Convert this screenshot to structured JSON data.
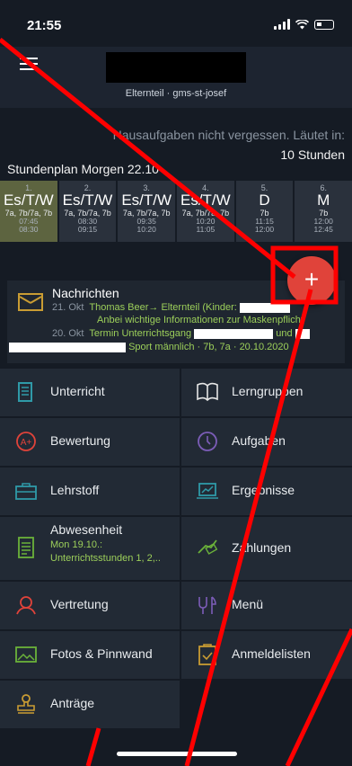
{
  "status": {
    "time": "21:55"
  },
  "header": {
    "subtitle": "Elternteil · gms-st-josef"
  },
  "banner": {
    "homework": "Hausaufgaben nicht vergessen. Läutet in:",
    "countdown": "10 Stunden"
  },
  "plan": {
    "title": "Stundenplan Morgen 22.10",
    "lessons": [
      {
        "num": "1.",
        "subject": "Es/T/W",
        "classes": "7a, 7b/7a, 7b",
        "start": "07:45",
        "end": "08:30"
      },
      {
        "num": "2.",
        "subject": "Es/T/W",
        "classes": "7a, 7b/7a, 7b",
        "start": "08:30",
        "end": "09:15"
      },
      {
        "num": "3.",
        "subject": "Es/T/W",
        "classes": "7a, 7b/7a, 7b",
        "start": "09:35",
        "end": "10:20"
      },
      {
        "num": "4.",
        "subject": "Es/T/W",
        "classes": "7a, 7b/7a, 7b",
        "start": "10:20",
        "end": "11:05"
      },
      {
        "num": "5.",
        "subject": "D",
        "classes": "7b",
        "start": "11:15",
        "end": "12:00"
      },
      {
        "num": "6.",
        "subject": "M",
        "classes": "7b",
        "start": "12:00",
        "end": "12:45"
      }
    ]
  },
  "fab": {
    "label": "+"
  },
  "news": {
    "title": "Nachrichten",
    "items": [
      {
        "date": "21. Okt",
        "line1": "Thomas Beer→ Elternteil (Kinder:",
        "line2": "Anbei wichtige Informationen zur Maskenpflicht"
      },
      {
        "date": "20. Okt",
        "line1": "Termin Unterrichtsgang",
        "line1_tail": "und",
        "line2": "Sport männlich · 7b, 7a · 20.10.2020"
      }
    ]
  },
  "menu": {
    "unterricht": "Unterricht",
    "lerngruppen": "Lerngruppen",
    "bewertung": "Bewertung",
    "aufgaben": "Aufgaben",
    "lehrstoff": "Lehrstoff",
    "ergebnisse": "Ergebnisse",
    "abwesenheit": "Abwesenheit",
    "abwesenheit_date": "Mon 19.10.:",
    "abwesenheit_detail": "Unterrichtsstunden 1, 2,..",
    "zahlungen": "Zahlungen",
    "vertretung": "Vertretung",
    "menue": "Menü",
    "fotos": "Fotos & Pinnwand",
    "anmeldelisten": "Anmeldelisten",
    "antraege": "Anträge"
  },
  "colors": {
    "accent_green": "#9ccf5a",
    "fab_red": "#e0433a",
    "icon_orange": "#c99c33",
    "icon_teal": "#2f9aa8",
    "icon_purple": "#7c5db8"
  }
}
